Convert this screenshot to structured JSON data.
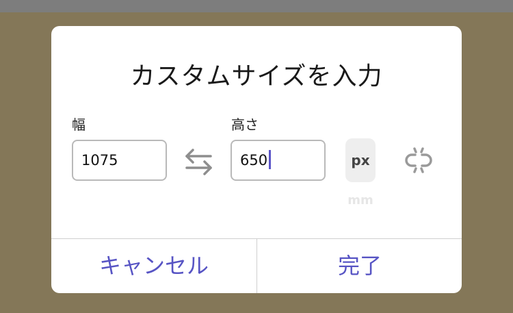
{
  "dialog": {
    "title": "カスタムサイズを入力",
    "width_label": "幅",
    "width_value": "1075",
    "height_label": "高さ",
    "height_value": "650",
    "unit_selected": "px",
    "unit_other": "mm",
    "swap_icon": "swap-arrows-icon",
    "link_icon": "unlink-chain-icon",
    "cancel_label": "キャンセル",
    "done_label": "完了"
  },
  "colors": {
    "accent": "#5754c4",
    "backdrop": "#847758",
    "caret": "#5b55c8"
  }
}
